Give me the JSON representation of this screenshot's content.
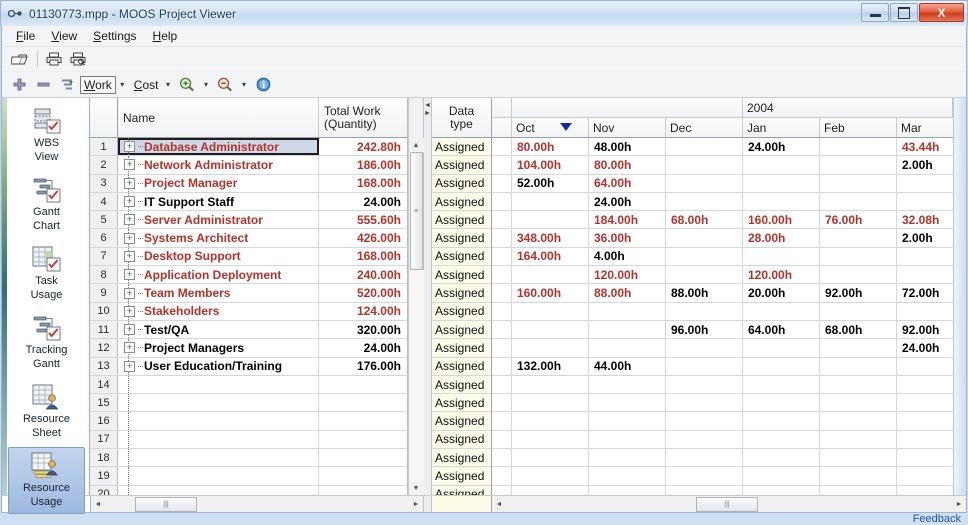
{
  "window": {
    "title": "01130773.mpp - MOOS Project Viewer",
    "app_icon": "project-viewer-icon",
    "minimize_label": "Minimize",
    "maximize_label": "Maximize",
    "close_label": "X"
  },
  "menu": [
    {
      "label": "File",
      "accel": "F"
    },
    {
      "label": "View",
      "accel": "V"
    },
    {
      "label": "Settings",
      "accel": "S"
    },
    {
      "label": "Help",
      "accel": "H"
    }
  ],
  "toolbar_top": [
    {
      "name": "open-file-button",
      "icon": "open-folder-icon",
      "label": "Open"
    },
    {
      "name": "print-button",
      "icon": "printer-icon",
      "label": "Print"
    },
    {
      "name": "print-preview-button",
      "icon": "print-preview-icon",
      "label": "Print Preview"
    }
  ],
  "toolbar_bottom": {
    "expand_all": {
      "name": "expand-all-button",
      "icon": "plus-icon"
    },
    "collapse_all": {
      "name": "collapse-all-button",
      "icon": "minus-icon"
    },
    "outline": {
      "name": "outline-button",
      "icon": "outline-icon"
    },
    "work_label": "Work",
    "work_accel": "W",
    "cost_label": "Cost",
    "cost_accel": "C",
    "zoom_in": {
      "name": "zoom-in-button",
      "icon": "zoom-in-icon"
    },
    "zoom_out": {
      "name": "zoom-out-button",
      "icon": "zoom-out-icon"
    },
    "info": {
      "name": "info-button",
      "icon": "info-icon"
    },
    "dropdown_glyph": "▾"
  },
  "viewbar": {
    "items": [
      {
        "label_line1": "WBS",
        "label_line2": "View",
        "icon": "wbs-view-icon",
        "selected": false
      },
      {
        "label_line1": "Gantt",
        "label_line2": "Chart",
        "icon": "gantt-chart-icon",
        "selected": false
      },
      {
        "label_line1": "Task",
        "label_line2": "Usage",
        "icon": "task-usage-icon",
        "selected": false
      },
      {
        "label_line1": "Tracking",
        "label_line2": "Gantt",
        "icon": "tracking-gantt-icon",
        "selected": false
      },
      {
        "label_line1": "Resource",
        "label_line2": "Sheet",
        "icon": "resource-sheet-icon",
        "selected": false
      },
      {
        "label_line1": "Resource",
        "label_line2": "Usage",
        "icon": "resource-usage-icon",
        "selected": true
      }
    ]
  },
  "grid": {
    "columns": {
      "name": "Name",
      "total_work_line1": "Total Work",
      "total_work_line2": "(Quantity)",
      "data_type_line1": "Data",
      "data_type_line2": "type"
    },
    "data_type_value": "Assigned",
    "rows": [
      {
        "num": "1",
        "name": "Database Administrator",
        "work": "242.80h",
        "color": "red",
        "selected": true,
        "months": [
          "80.00h",
          "48.00h",
          "",
          "24.00h",
          "",
          "43.44h"
        ],
        "month_colors": [
          "red",
          "black",
          "black",
          "black",
          "black",
          "red"
        ]
      },
      {
        "num": "2",
        "name": "Network Administrator",
        "work": "186.00h",
        "color": "red",
        "selected": false,
        "months": [
          "104.00h",
          "80.00h",
          "",
          "",
          "",
          "2.00h"
        ],
        "month_colors": [
          "red",
          "red",
          "black",
          "black",
          "black",
          "black"
        ]
      },
      {
        "num": "3",
        "name": "Project Manager",
        "work": "168.00h",
        "color": "red",
        "selected": false,
        "months": [
          "52.00h",
          "64.00h",
          "",
          "",
          "",
          ""
        ],
        "month_colors": [
          "black",
          "red",
          "black",
          "black",
          "black",
          "black"
        ]
      },
      {
        "num": "4",
        "name": "IT Support Staff",
        "work": "24.00h",
        "color": "black",
        "selected": false,
        "months": [
          "",
          "24.00h",
          "",
          "",
          "",
          ""
        ],
        "month_colors": [
          "black",
          "black",
          "black",
          "black",
          "black",
          "black"
        ]
      },
      {
        "num": "5",
        "name": "Server Administrator",
        "work": "555.60h",
        "color": "red",
        "selected": false,
        "months": [
          "",
          "184.00h",
          "68.00h",
          "160.00h",
          "76.00h",
          "32.08h"
        ],
        "month_colors": [
          "black",
          "red",
          "red",
          "red",
          "red",
          "red"
        ]
      },
      {
        "num": "6",
        "name": "Systems Architect",
        "work": "426.00h",
        "color": "red",
        "selected": false,
        "months": [
          "348.00h",
          "36.00h",
          "",
          "28.00h",
          "",
          "2.00h"
        ],
        "month_colors": [
          "red",
          "red",
          "black",
          "red",
          "black",
          "black"
        ]
      },
      {
        "num": "7",
        "name": "Desktop Support",
        "work": "168.00h",
        "color": "red",
        "selected": false,
        "months": [
          "164.00h",
          "4.00h",
          "",
          "",
          "",
          ""
        ],
        "month_colors": [
          "red",
          "black",
          "black",
          "black",
          "black",
          "black"
        ]
      },
      {
        "num": "8",
        "name": "Application Deployment",
        "work": "240.00h",
        "color": "red",
        "selected": false,
        "months": [
          "",
          "120.00h",
          "",
          "120.00h",
          "",
          ""
        ],
        "month_colors": [
          "black",
          "red",
          "black",
          "red",
          "black",
          "black"
        ]
      },
      {
        "num": "9",
        "name": "Team Members",
        "work": "520.00h",
        "color": "red",
        "selected": false,
        "months": [
          "160.00h",
          "88.00h",
          "88.00h",
          "20.00h",
          "92.00h",
          "72.00h"
        ],
        "month_colors": [
          "red",
          "red",
          "black",
          "black",
          "black",
          "black"
        ]
      },
      {
        "num": "10",
        "name": "Stakeholders",
        "work": "124.00h",
        "color": "red",
        "selected": false,
        "months": [
          "",
          "",
          "",
          "",
          "",
          ""
        ],
        "month_colors": [
          "black",
          "black",
          "black",
          "black",
          "black",
          "black"
        ]
      },
      {
        "num": "11",
        "name": "Test/QA",
        "work": "320.00h",
        "color": "black",
        "selected": false,
        "months": [
          "",
          "",
          "96.00h",
          "64.00h",
          "68.00h",
          "92.00h"
        ],
        "month_colors": [
          "black",
          "black",
          "black",
          "black",
          "black",
          "black"
        ]
      },
      {
        "num": "12",
        "name": "Project Managers",
        "work": "24.00h",
        "color": "black",
        "selected": false,
        "months": [
          "",
          "",
          "",
          "",
          "",
          "24.00h"
        ],
        "month_colors": [
          "black",
          "black",
          "black",
          "black",
          "black",
          "black"
        ]
      },
      {
        "num": "13",
        "name": "User Education/Training",
        "work": "176.00h",
        "color": "black",
        "selected": false,
        "months": [
          "132.00h",
          "44.00h",
          "",
          "",
          "",
          ""
        ],
        "month_colors": [
          "black",
          "black",
          "black",
          "black",
          "black",
          "black"
        ]
      },
      {
        "num": "14",
        "name": "",
        "work": "",
        "color": "black",
        "selected": false,
        "months": [
          "",
          "",
          "",
          "",
          "",
          ""
        ],
        "month_colors": [
          "black",
          "black",
          "black",
          "black",
          "black",
          "black"
        ]
      },
      {
        "num": "15",
        "name": "",
        "work": "",
        "color": "black",
        "selected": false,
        "months": [
          "",
          "",
          "",
          "",
          "",
          ""
        ],
        "month_colors": [
          "black",
          "black",
          "black",
          "black",
          "black",
          "black"
        ]
      },
      {
        "num": "16",
        "name": "",
        "work": "",
        "color": "black",
        "selected": false,
        "months": [
          "",
          "",
          "",
          "",
          "",
          ""
        ],
        "month_colors": [
          "black",
          "black",
          "black",
          "black",
          "black",
          "black"
        ]
      },
      {
        "num": "17",
        "name": "",
        "work": "",
        "color": "black",
        "selected": false,
        "months": [
          "",
          "",
          "",
          "",
          "",
          ""
        ],
        "month_colors": [
          "black",
          "black",
          "black",
          "black",
          "black",
          "black"
        ]
      },
      {
        "num": "18",
        "name": "",
        "work": "",
        "color": "black",
        "selected": false,
        "months": [
          "",
          "",
          "",
          "",
          "",
          ""
        ],
        "month_colors": [
          "black",
          "black",
          "black",
          "black",
          "black",
          "black"
        ]
      },
      {
        "num": "19",
        "name": "",
        "work": "",
        "color": "black",
        "selected": false,
        "months": [
          "",
          "",
          "",
          "",
          "",
          ""
        ],
        "month_colors": [
          "black",
          "black",
          "black",
          "black",
          "black",
          "black"
        ]
      },
      {
        "num": "20",
        "name": "",
        "work": "",
        "color": "black",
        "selected": false,
        "months": [
          "",
          "",
          "",
          "",
          "",
          ""
        ],
        "month_colors": [
          "black",
          "black",
          "black",
          "black",
          "black",
          "black"
        ]
      }
    ]
  },
  "timeline": {
    "year_label": "2004",
    "year_blank": "",
    "months": [
      "Oct",
      "Nov",
      "Dec",
      "Jan",
      "Feb",
      "Mar"
    ],
    "sorted_column": "Oct",
    "sort_glyph": "▼"
  },
  "scroll": {
    "up_arrow": "▲",
    "down_arrow": "▼",
    "left_arrow": "◄",
    "right_arrow": "►",
    "grip": "|||"
  },
  "status": {
    "feedback_label": "Feedback"
  },
  "colors": {
    "overallocated": "#b3332b",
    "normal": "#000000",
    "selection": "#ced8e6",
    "datatype_bg": "#fbfbe8",
    "link": "#2255aa",
    "titlebar": "#c3d8ee"
  }
}
